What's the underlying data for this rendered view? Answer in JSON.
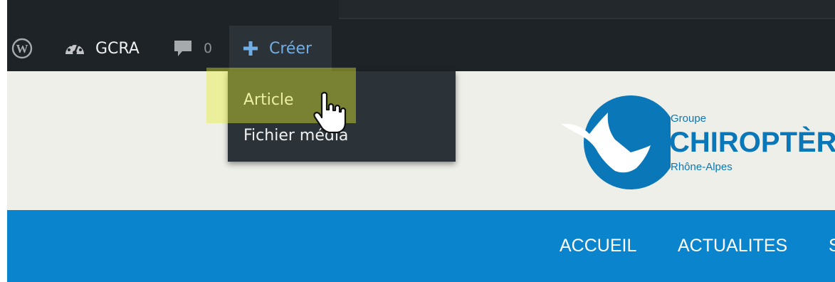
{
  "admin_bar": {
    "site_name": "GCRA",
    "comment_count": "0",
    "new_label": "Créer",
    "icons": {
      "wordpress": "wordpress-logo-icon",
      "dashboard": "dashboard-icon",
      "comments": "comment-bubble-icon",
      "new": "plus-icon"
    }
  },
  "dropdown": {
    "items": [
      {
        "label": "Article"
      },
      {
        "label": "Fichier média"
      }
    ],
    "highlighted": "Article"
  },
  "logo": {
    "line1": "Groupe",
    "line2": "CHIROPTÈRES",
    "line3": "Rhône-Alpes"
  },
  "nav": {
    "items": [
      "ACCUEIL",
      "ACTUALITES",
      "S"
    ]
  },
  "colors": {
    "admin_bar": "#1d2327",
    "submenu": "#2c3338",
    "accent_link": "#72aee6",
    "header_bg": "#efefea",
    "nav_bg": "#0a84cc",
    "logo_blue": "#0a77b8",
    "highlight": "#e5ee2d"
  }
}
